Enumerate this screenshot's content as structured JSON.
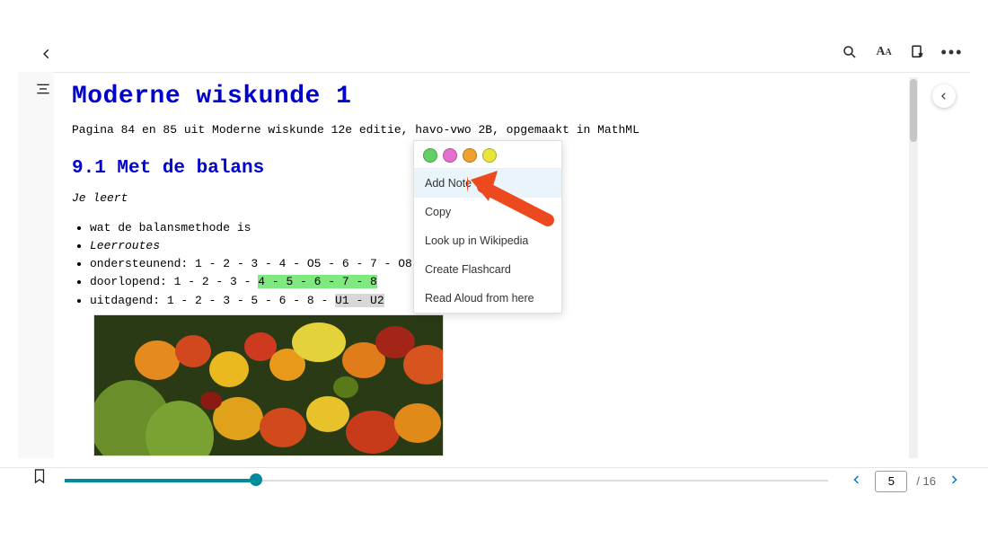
{
  "document": {
    "title": "Moderne wiskunde 1",
    "subtitle": "Pagina 84 en 85 uit Moderne wiskunde 12e editie, havo-vwo 2B, opgemaakt in MathML",
    "section_heading": "9.1 Met de balans",
    "lead": "Je leert",
    "bullets": {
      "b1": "wat de balansmethode is",
      "b2": "Leerroutes",
      "b3_pre": "ondersteunend: 1 - 2 - 3 - 4 - O5 - 6 - 7 - O8",
      "b4_pre": "doorlopend: 1 - 2 - 3 - ",
      "b4_hl": "4 - 5 - 6 - 7 - 8",
      "b5_pre": "uitdagend: 1 - 2 - 3 - 5 - 6 - 8 - ",
      "b5_hl": "U1 - U2"
    }
  },
  "context_menu": {
    "colors": [
      "#63d063",
      "#e66fcf",
      "#f0a02e",
      "#e8e63a"
    ],
    "items": {
      "add_note": "Add Note",
      "copy": "Copy",
      "lookup": "Look up in Wikipedia",
      "flashcard": "Create Flashcard",
      "read_aloud": "Read Aloud from here"
    }
  },
  "pager": {
    "current": "5",
    "total": "/ 16",
    "progress_percent": 25
  }
}
